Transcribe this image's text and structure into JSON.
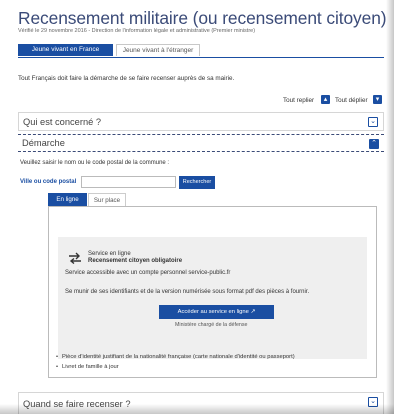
{
  "header": {
    "title": "Recensement militaire (ou recensement citoyen)",
    "date": "Vérifié le 29 novembre 2016 - Direction de l'information légale et administrative (Premier ministre)"
  },
  "tabs": [
    {
      "label": "Jeune vivant en France",
      "active": true
    },
    {
      "label": "Jeune vivant à l'étranger",
      "active": false
    }
  ],
  "intro_text": "Tout Français doit faire la démarche de se faire recenser auprès de sa mairie.",
  "toggles": {
    "collapse_all": "Tout replier",
    "expand_all": "Tout déplier"
  },
  "accordions": [
    {
      "title": "Qui est concerné ?",
      "expanded": false
    },
    {
      "title": "Démarche",
      "expanded": true
    },
    {
      "title": "Quand se faire recenser ?",
      "expanded": false
    }
  ],
  "demarche": {
    "instruction": "Veuillez saisir le nom ou le code postal de la commune :",
    "input_label": "Ville ou code postal",
    "input_value": "",
    "search_label": "Rechercher",
    "inner_tabs": [
      {
        "label": "En ligne",
        "active": true
      },
      {
        "label": "Sur place",
        "active": false
      }
    ],
    "service": {
      "kind": "Service en ligne",
      "name": "Recensement citoyen obligatoire",
      "account_text": "Service accessible avec un compte personnel service-public.fr",
      "docs_text": "Se munir de ses identifiants et de la version numérisée sous format pdf des pièces à fournir.",
      "button_label": "Accéder au service en ligne",
      "ministry": "Ministère chargé de la défense"
    },
    "documents": [
      "Pièce d'identité justifiant de la nationalité française (carte nationale d'identité ou passeport)",
      "Livret de famille à jour"
    ]
  },
  "colors": {
    "primary": "#1a4ea2",
    "title": "#3b4b78"
  }
}
